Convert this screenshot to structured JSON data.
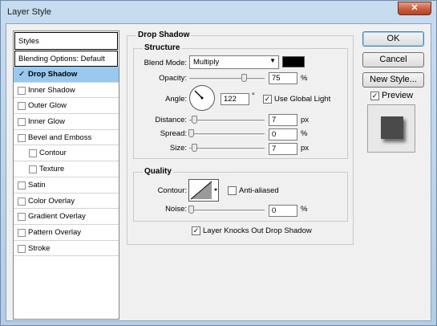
{
  "window": {
    "title": "Layer Style",
    "close_glyph": "✕"
  },
  "styles_panel": {
    "header": "Styles",
    "blending_options": "Blending Options: Default",
    "items": [
      {
        "label": "Drop Shadow",
        "checked": true,
        "active": true
      },
      {
        "label": "Inner Shadow",
        "checked": false
      },
      {
        "label": "Outer Glow",
        "checked": false
      },
      {
        "label": "Inner Glow",
        "checked": false
      },
      {
        "label": "Bevel and Emboss",
        "checked": false
      },
      {
        "label": "Contour",
        "checked": false,
        "sub": true
      },
      {
        "label": "Texture",
        "checked": false,
        "sub": true
      },
      {
        "label": "Satin",
        "checked": false
      },
      {
        "label": "Color Overlay",
        "checked": false
      },
      {
        "label": "Gradient Overlay",
        "checked": false
      },
      {
        "label": "Pattern Overlay",
        "checked": false
      },
      {
        "label": "Stroke",
        "checked": false
      }
    ]
  },
  "drop_shadow": {
    "title": "Drop Shadow",
    "structure": {
      "title": "Structure",
      "blend_mode_label": "Blend Mode:",
      "blend_mode_value": "Multiply",
      "shadow_color": "#000000",
      "opacity_label": "Opacity:",
      "opacity_value": "75",
      "opacity_unit": "%",
      "angle_label": "Angle:",
      "angle_value": "122",
      "angle_unit": "°",
      "use_global_light_label": "Use Global Light",
      "use_global_light_checked": true,
      "distance_label": "Distance:",
      "distance_value": "7",
      "distance_unit": "px",
      "spread_label": "Spread:",
      "spread_value": "0",
      "spread_unit": "%",
      "size_label": "Size:",
      "size_value": "7",
      "size_unit": "px"
    },
    "quality": {
      "title": "Quality",
      "contour_label": "Contour:",
      "anti_aliased_label": "Anti-aliased",
      "anti_aliased_checked": false,
      "noise_label": "Noise:",
      "noise_value": "0",
      "noise_unit": "%"
    },
    "knockout_label": "Layer Knocks Out Drop Shadow",
    "knockout_checked": true
  },
  "buttons": {
    "ok": "OK",
    "cancel": "Cancel",
    "new_style": "New Style..."
  },
  "preview": {
    "label": "Preview",
    "checked": true
  },
  "check_glyph": "✓"
}
